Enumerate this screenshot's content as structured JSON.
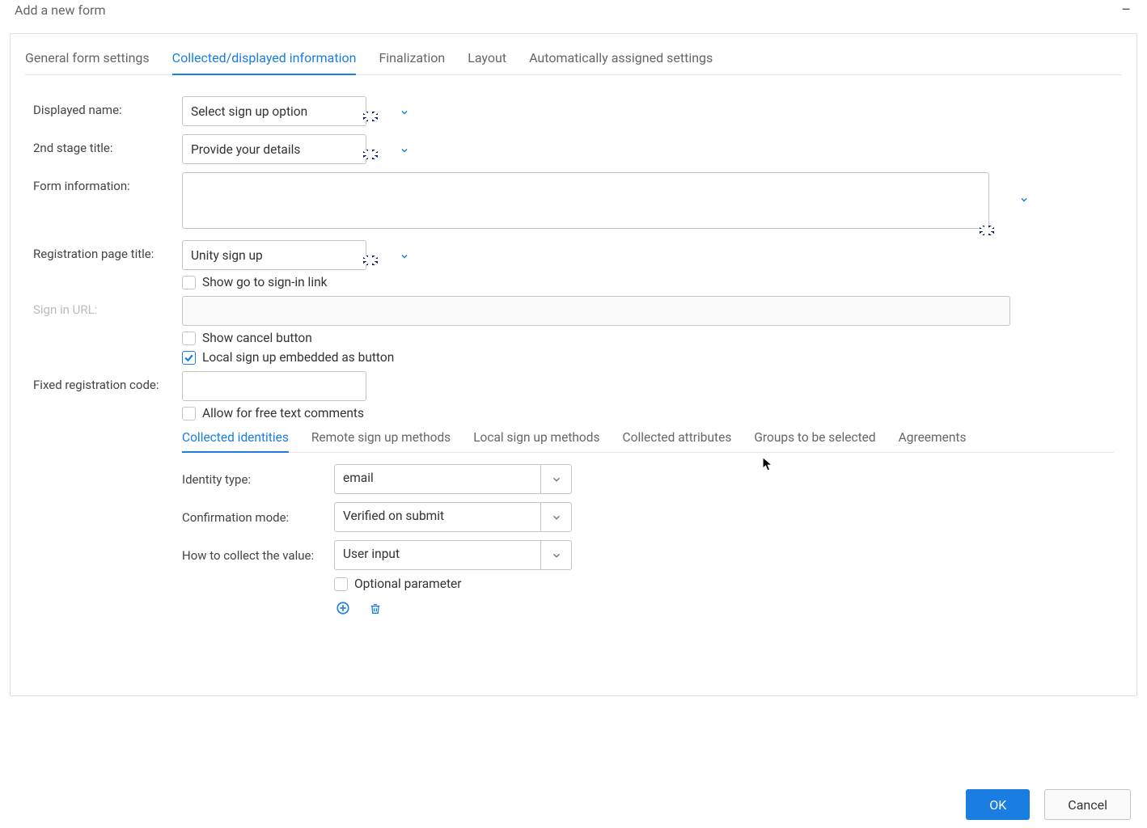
{
  "window": {
    "title": "Add a new form"
  },
  "tabs": [
    {
      "label": "General form settings"
    },
    {
      "label": "Collected/displayed information"
    },
    {
      "label": "Finalization"
    },
    {
      "label": "Layout"
    },
    {
      "label": "Automatically assigned settings"
    }
  ],
  "active_tab": 1,
  "fields": {
    "displayed_name": {
      "label": "Displayed name:",
      "value": "Select sign up option"
    },
    "second_stage_title": {
      "label": "2nd stage title:",
      "value": "Provide your details"
    },
    "form_information": {
      "label": "Form information:",
      "value": ""
    },
    "registration_page_title": {
      "label": "Registration page title:",
      "value": "Unity sign up"
    },
    "show_signin_link": {
      "label": "Show go to sign-in link",
      "checked": false
    },
    "signin_url": {
      "label": "Sign in URL:",
      "value": "",
      "disabled": true
    },
    "show_cancel_button": {
      "label": "Show cancel button",
      "checked": false
    },
    "local_signup_embedded": {
      "label": "Local sign up embedded as button",
      "checked": true
    },
    "fixed_registration_code": {
      "label": "Fixed registration code:",
      "value": ""
    },
    "allow_free_text_comments": {
      "label": "Allow for free text comments",
      "checked": false
    }
  },
  "subtabs": [
    {
      "label": "Collected identities"
    },
    {
      "label": "Remote sign up methods"
    },
    {
      "label": "Local sign up methods"
    },
    {
      "label": "Collected attributes"
    },
    {
      "label": "Groups to be selected"
    },
    {
      "label": "Agreements"
    }
  ],
  "active_subtab": 0,
  "identities": {
    "identity_type": {
      "label": "Identity type:",
      "value": "email"
    },
    "confirmation_mode": {
      "label": "Confirmation mode:",
      "value": "Verified on submit"
    },
    "how_to_collect": {
      "label": "How to collect the value:",
      "value": "User input"
    },
    "optional_parameter": {
      "label": "Optional parameter",
      "checked": false
    }
  },
  "footer": {
    "ok": "OK",
    "cancel": "Cancel"
  },
  "colors": {
    "accent": "#197de1",
    "border": "#c5c5c5",
    "text": "#444"
  }
}
